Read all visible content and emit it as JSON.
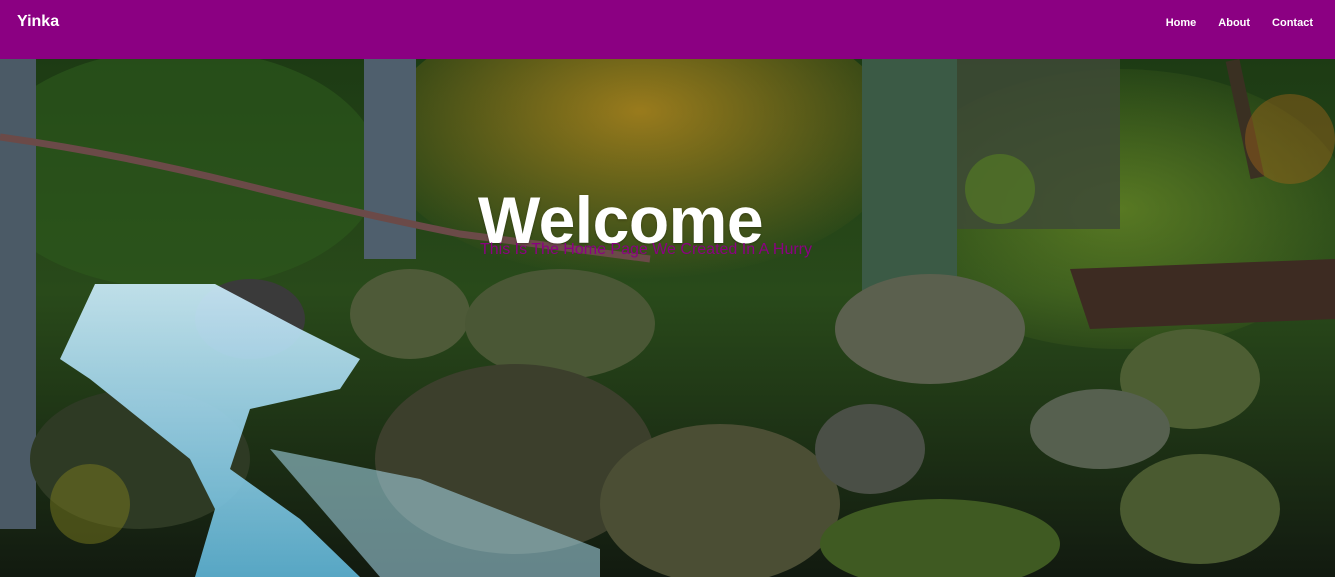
{
  "nav": {
    "brand": "Yinka",
    "links": [
      "Home",
      "About",
      "Contact"
    ]
  },
  "hero": {
    "title": "Welcome",
    "subtitle": "This Is The Home Page We Created In A Hurry"
  },
  "colors": {
    "navbar_bg": "#8b0082",
    "nav_text": "#ffffff",
    "subtitle_text": "#8b0082"
  }
}
